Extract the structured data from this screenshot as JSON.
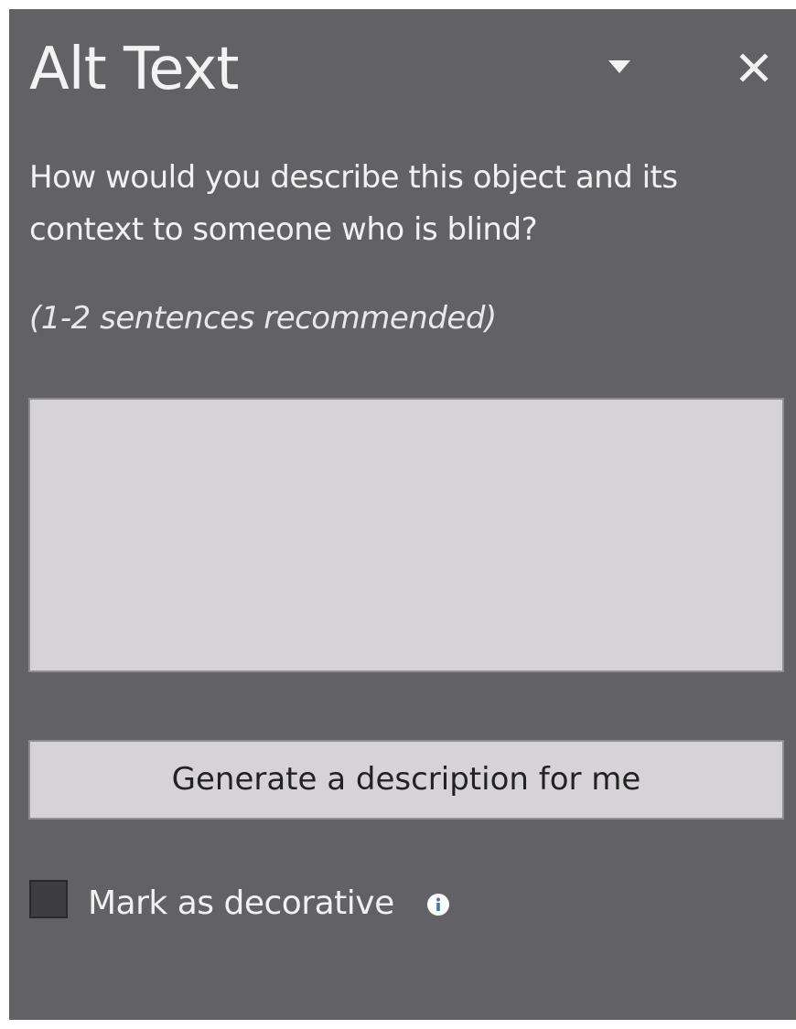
{
  "pane": {
    "title": "Alt Text",
    "dropdown_icon": "chevron-down-icon",
    "close_icon": "close-icon"
  },
  "prompt": {
    "question": "How would you describe this object and its context to someone who is blind?",
    "hint": "(1-2 sentences recommended)"
  },
  "description_field": {
    "value": "",
    "placeholder": ""
  },
  "generate_button": {
    "label": "Generate a description for me"
  },
  "decorative": {
    "label": "Mark as decorative",
    "checked": false,
    "info_icon": "info-icon"
  },
  "colors": {
    "pane_background": "#626164",
    "field_background": "#d5d3d6",
    "text": "#f1f1f1"
  }
}
